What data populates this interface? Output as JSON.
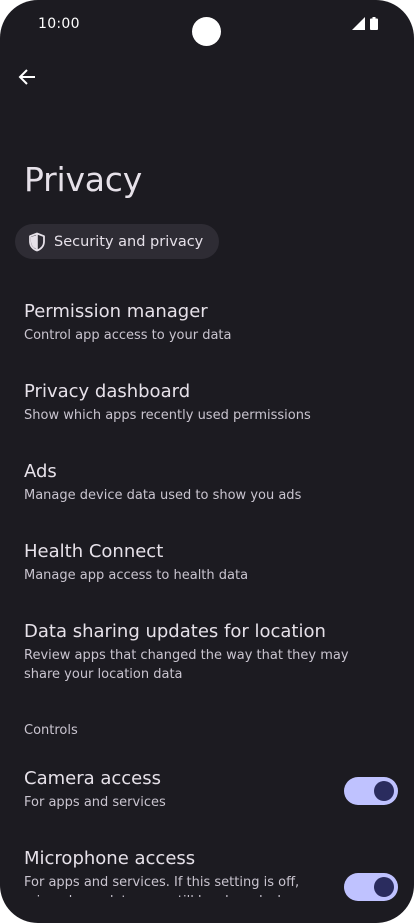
{
  "status_bar": {
    "time": "10:00"
  },
  "header": {
    "back_icon": "arrow-back-icon",
    "title": "Privacy"
  },
  "chip": {
    "icon": "shield-icon",
    "label": "Security and privacy"
  },
  "items": [
    {
      "title": "Permission manager",
      "subtitle": "Control app access to your data"
    },
    {
      "title": "Privacy dashboard",
      "subtitle": "Show which apps recently used permissions"
    },
    {
      "title": "Ads",
      "subtitle": "Manage device data used to show you ads"
    },
    {
      "title": "Health Connect",
      "subtitle": "Manage app access to health data"
    },
    {
      "title": "Data sharing updates for location",
      "subtitle": "Review apps that changed the way that they may share your location data"
    }
  ],
  "controls": {
    "header": "Controls",
    "toggles": [
      {
        "title": "Camera access",
        "subtitle": "For apps and services",
        "on": true
      },
      {
        "title": "Microphone access",
        "subtitle": "For apps and services. If this setting is off, microphone data may still be shared when you",
        "on": true
      }
    ]
  },
  "colors": {
    "background": "#1c1b21",
    "chip_background": "#2e2c34",
    "toggle_track": "#bfc2ff",
    "toggle_thumb": "#2a2c5e",
    "text_primary": "#e6e1e9",
    "text_secondary": "#c9c4cf"
  }
}
